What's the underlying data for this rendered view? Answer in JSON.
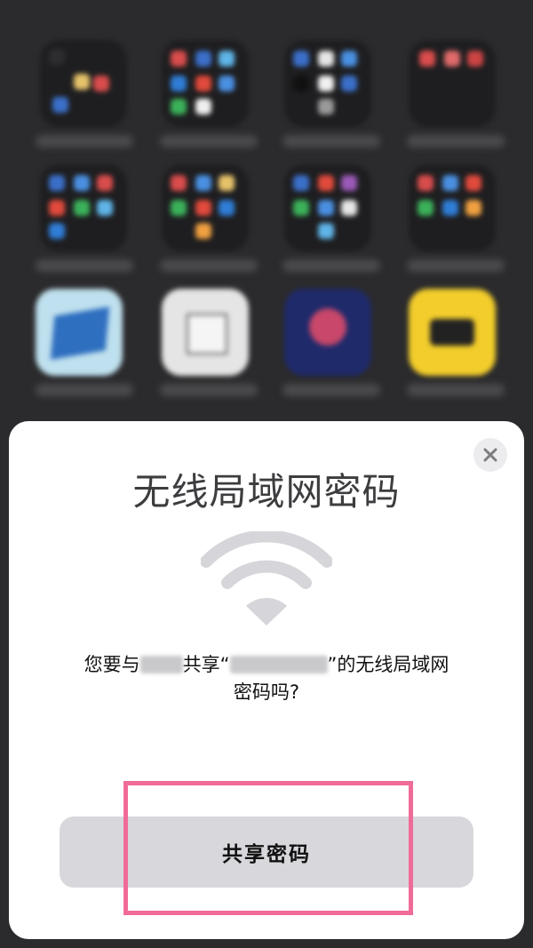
{
  "dialog": {
    "title": "无线局域网密码",
    "message_part1": "您要与",
    "message_part2": "共享“",
    "message_part3": "”的无线局域网",
    "message_line2": "密码吗?",
    "share_button_label": "共享密码",
    "close_symbol": "×"
  },
  "icons": {
    "close": "close-icon",
    "wifi": "wifi-icon"
  },
  "colors": {
    "sheet_background": "#ffffff",
    "button_background": "#d8d7dc",
    "highlight_border": "#f06b97",
    "wifi_icon": "#d6d6da"
  }
}
